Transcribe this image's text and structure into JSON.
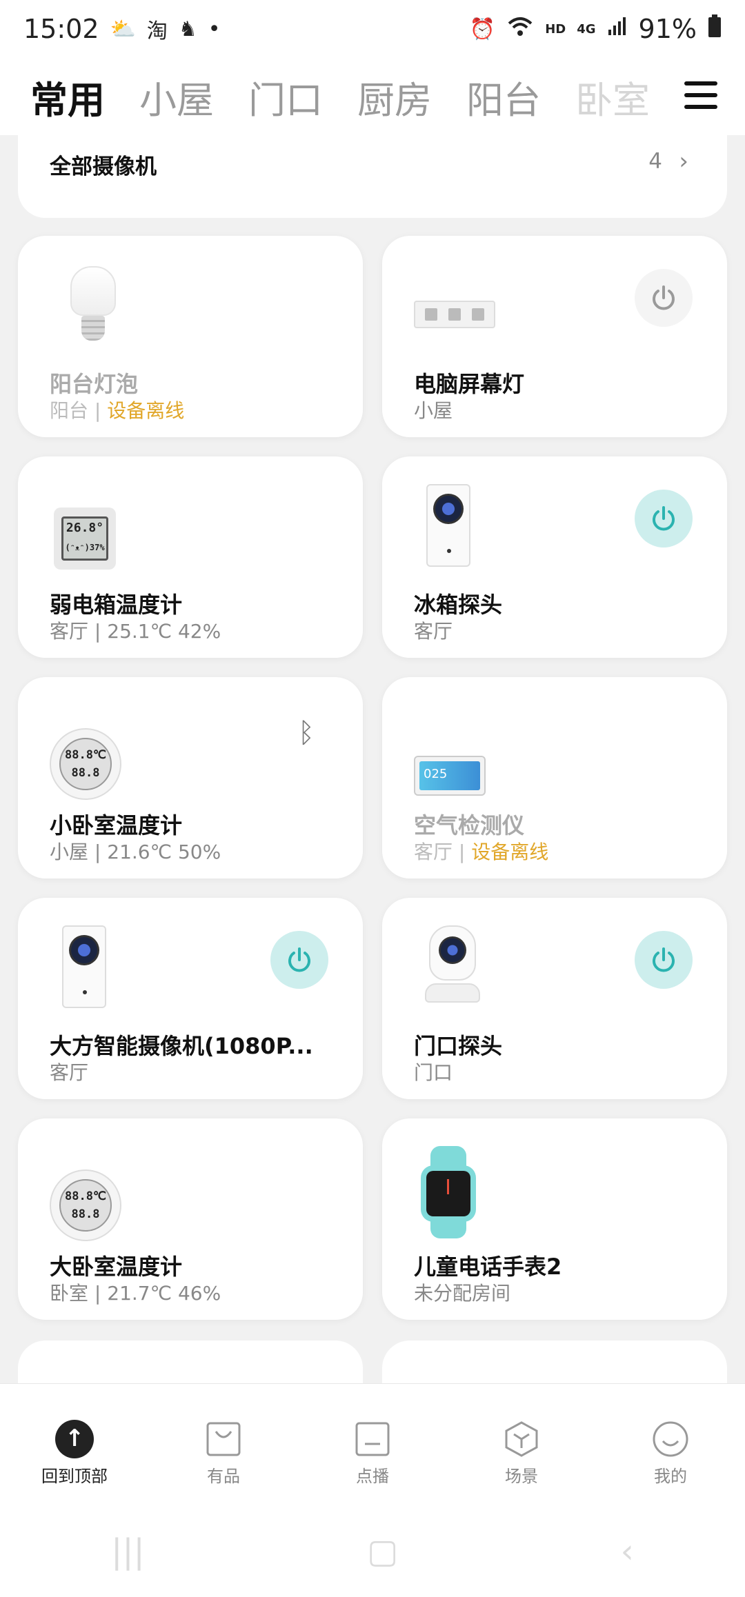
{
  "statusbar": {
    "time": "15:02",
    "left_icons": [
      "weather-icon",
      "taobao-icon",
      "app-icon"
    ],
    "dot": "•",
    "hd": "HD",
    "net": "4G",
    "battery": "91%"
  },
  "tabs": [
    "常用",
    "小屋",
    "门口",
    "厨房",
    "阳台",
    "卧室"
  ],
  "camera_section": {
    "title": "全部摄像机",
    "count": "4",
    "arrow": "›"
  },
  "devices": [
    {
      "name": "阳台灯泡",
      "room": "阳台",
      "sep": " | ",
      "status": "设备离线",
      "offline": true,
      "power": false,
      "bluetooth": false,
      "icon": "bulb"
    },
    {
      "name": "电脑屏幕灯",
      "room": "小屋",
      "sep": "",
      "status": "",
      "offline": false,
      "power": true,
      "power_on": false,
      "bluetooth": false,
      "icon": "bar-lamp"
    },
    {
      "name": "弱电箱温度计",
      "room": "客厅",
      "sep": " | ",
      "status": "25.1℃ 42%",
      "offline": false,
      "power": false,
      "bluetooth": false,
      "icon": "thermometer-square",
      "screen_lines": [
        "26.8°",
        "(ᵔᴥᵔ)37%"
      ]
    },
    {
      "name": "冰箱探头",
      "room": "客厅",
      "sep": "",
      "status": "",
      "offline": false,
      "power": true,
      "power_on": true,
      "bluetooth": false,
      "icon": "camera-box"
    },
    {
      "name": "小卧室温度计",
      "room": "小屋",
      "sep": " | ",
      "status": "21.6℃ 50%",
      "offline": false,
      "power": false,
      "bluetooth": true,
      "icon": "thermometer-round",
      "screen_lines": [
        "88.8℃",
        "88.8"
      ]
    },
    {
      "name": "空气检测仪",
      "room": "客厅",
      "sep": " | ",
      "status": "设备离线",
      "offline": true,
      "power": false,
      "bluetooth": false,
      "icon": "air-monitor",
      "screen_text": "025"
    },
    {
      "name": "大方智能摄像机(1080P...",
      "room": "客厅",
      "sep": "",
      "status": "",
      "offline": false,
      "power": true,
      "power_on": true,
      "bluetooth": false,
      "icon": "camera-box"
    },
    {
      "name": "门口探头",
      "room": "门口",
      "sep": "",
      "status": "",
      "offline": false,
      "power": true,
      "power_on": true,
      "bluetooth": false,
      "icon": "mini-camera"
    },
    {
      "name": "大卧室温度计",
      "room": "卧室",
      "sep": " | ",
      "status": "21.7℃ 46%",
      "offline": false,
      "power": false,
      "bluetooth": false,
      "icon": "thermometer-round",
      "screen_lines": [
        "88.8℃",
        "88.8"
      ]
    },
    {
      "name": "儿童电话手表2",
      "room": "未分配房间",
      "sep": "",
      "status": "",
      "offline": false,
      "power": false,
      "bluetooth": false,
      "icon": "kids-watch"
    }
  ],
  "bottom_nav": [
    {
      "label": "回到顶部",
      "icon": "arrow-up-icon",
      "active": true
    },
    {
      "label": "有品",
      "icon": "shopping-bag-icon",
      "active": false
    },
    {
      "label": "点播",
      "icon": "tv-icon",
      "active": false
    },
    {
      "label": "场景",
      "icon": "cube-icon",
      "active": false
    },
    {
      "label": "我的",
      "icon": "smile-icon",
      "active": false
    }
  ],
  "colors": {
    "offline": "#e1a72a",
    "power_on_bg": "#cdeeed",
    "power_on_fg": "#2bb3b0",
    "power_off_fg": "#9a9a9a"
  }
}
